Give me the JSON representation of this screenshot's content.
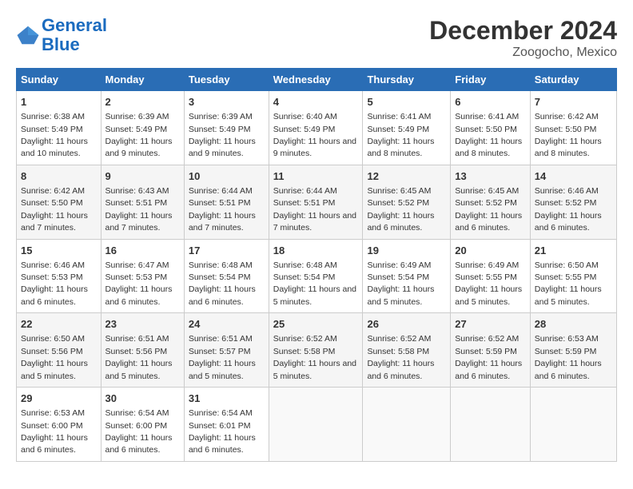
{
  "logo": {
    "line1": "General",
    "line2": "Blue"
  },
  "title": "December 2024",
  "subtitle": "Zoogocho, Mexico",
  "days_of_week": [
    "Sunday",
    "Monday",
    "Tuesday",
    "Wednesday",
    "Thursday",
    "Friday",
    "Saturday"
  ],
  "weeks": [
    [
      {
        "day": "1",
        "sunrise": "6:38 AM",
        "sunset": "5:49 PM",
        "daylight": "11 hours and 10 minutes."
      },
      {
        "day": "2",
        "sunrise": "6:39 AM",
        "sunset": "5:49 PM",
        "daylight": "11 hours and 9 minutes."
      },
      {
        "day": "3",
        "sunrise": "6:39 AM",
        "sunset": "5:49 PM",
        "daylight": "11 hours and 9 minutes."
      },
      {
        "day": "4",
        "sunrise": "6:40 AM",
        "sunset": "5:49 PM",
        "daylight": "11 hours and 9 minutes."
      },
      {
        "day": "5",
        "sunrise": "6:41 AM",
        "sunset": "5:49 PM",
        "daylight": "11 hours and 8 minutes."
      },
      {
        "day": "6",
        "sunrise": "6:41 AM",
        "sunset": "5:50 PM",
        "daylight": "11 hours and 8 minutes."
      },
      {
        "day": "7",
        "sunrise": "6:42 AM",
        "sunset": "5:50 PM",
        "daylight": "11 hours and 8 minutes."
      }
    ],
    [
      {
        "day": "8",
        "sunrise": "6:42 AM",
        "sunset": "5:50 PM",
        "daylight": "11 hours and 7 minutes."
      },
      {
        "day": "9",
        "sunrise": "6:43 AM",
        "sunset": "5:51 PM",
        "daylight": "11 hours and 7 minutes."
      },
      {
        "day": "10",
        "sunrise": "6:44 AM",
        "sunset": "5:51 PM",
        "daylight": "11 hours and 7 minutes."
      },
      {
        "day": "11",
        "sunrise": "6:44 AM",
        "sunset": "5:51 PM",
        "daylight": "11 hours and 7 minutes."
      },
      {
        "day": "12",
        "sunrise": "6:45 AM",
        "sunset": "5:52 PM",
        "daylight": "11 hours and 6 minutes."
      },
      {
        "day": "13",
        "sunrise": "6:45 AM",
        "sunset": "5:52 PM",
        "daylight": "11 hours and 6 minutes."
      },
      {
        "day": "14",
        "sunrise": "6:46 AM",
        "sunset": "5:52 PM",
        "daylight": "11 hours and 6 minutes."
      }
    ],
    [
      {
        "day": "15",
        "sunrise": "6:46 AM",
        "sunset": "5:53 PM",
        "daylight": "11 hours and 6 minutes."
      },
      {
        "day": "16",
        "sunrise": "6:47 AM",
        "sunset": "5:53 PM",
        "daylight": "11 hours and 6 minutes."
      },
      {
        "day": "17",
        "sunrise": "6:48 AM",
        "sunset": "5:54 PM",
        "daylight": "11 hours and 6 minutes."
      },
      {
        "day": "18",
        "sunrise": "6:48 AM",
        "sunset": "5:54 PM",
        "daylight": "11 hours and 5 minutes."
      },
      {
        "day": "19",
        "sunrise": "6:49 AM",
        "sunset": "5:54 PM",
        "daylight": "11 hours and 5 minutes."
      },
      {
        "day": "20",
        "sunrise": "6:49 AM",
        "sunset": "5:55 PM",
        "daylight": "11 hours and 5 minutes."
      },
      {
        "day": "21",
        "sunrise": "6:50 AM",
        "sunset": "5:55 PM",
        "daylight": "11 hours and 5 minutes."
      }
    ],
    [
      {
        "day": "22",
        "sunrise": "6:50 AM",
        "sunset": "5:56 PM",
        "daylight": "11 hours and 5 minutes."
      },
      {
        "day": "23",
        "sunrise": "6:51 AM",
        "sunset": "5:56 PM",
        "daylight": "11 hours and 5 minutes."
      },
      {
        "day": "24",
        "sunrise": "6:51 AM",
        "sunset": "5:57 PM",
        "daylight": "11 hours and 5 minutes."
      },
      {
        "day": "25",
        "sunrise": "6:52 AM",
        "sunset": "5:58 PM",
        "daylight": "11 hours and 5 minutes."
      },
      {
        "day": "26",
        "sunrise": "6:52 AM",
        "sunset": "5:58 PM",
        "daylight": "11 hours and 6 minutes."
      },
      {
        "day": "27",
        "sunrise": "6:52 AM",
        "sunset": "5:59 PM",
        "daylight": "11 hours and 6 minutes."
      },
      {
        "day": "28",
        "sunrise": "6:53 AM",
        "sunset": "5:59 PM",
        "daylight": "11 hours and 6 minutes."
      }
    ],
    [
      {
        "day": "29",
        "sunrise": "6:53 AM",
        "sunset": "6:00 PM",
        "daylight": "11 hours and 6 minutes."
      },
      {
        "day": "30",
        "sunrise": "6:54 AM",
        "sunset": "6:00 PM",
        "daylight": "11 hours and 6 minutes."
      },
      {
        "day": "31",
        "sunrise": "6:54 AM",
        "sunset": "6:01 PM",
        "daylight": "11 hours and 6 minutes."
      },
      null,
      null,
      null,
      null
    ]
  ]
}
